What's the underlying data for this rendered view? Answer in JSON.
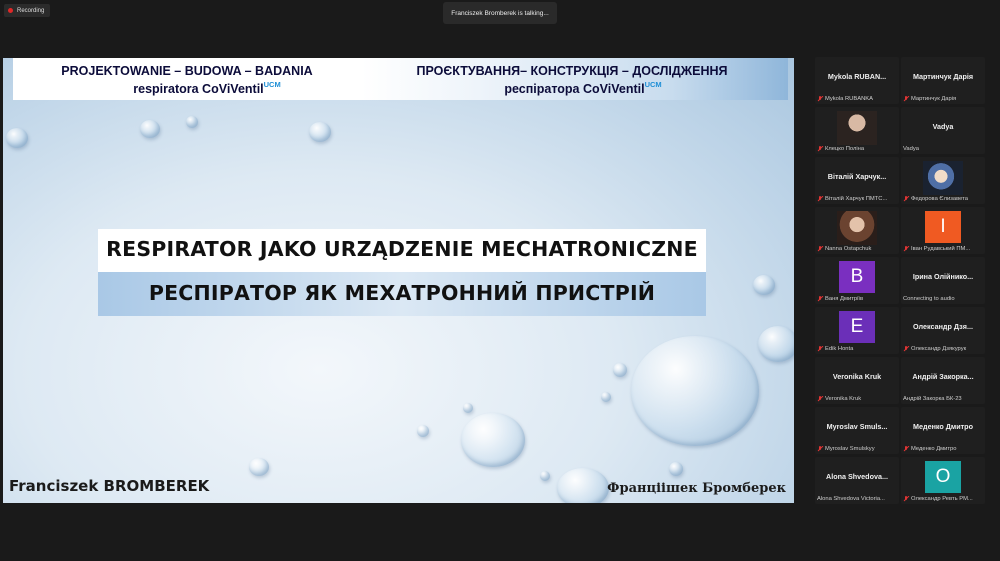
{
  "meeting": {
    "recording_label": "Recording",
    "talking_banner": "Franciszek Bromberek is talking..."
  },
  "slide": {
    "header_pl_line1": "PROJEKTOWANIE – BUDOWA – BADANIA",
    "header_pl_line2": "respiratora CoViVentil",
    "header_ua_line1": "ПРОЄКТУВАННЯ– КОНСТРУКЦІЯ – ДОСЛІДЖЕННЯ",
    "header_ua_line2": "респіратора  CoViVentil",
    "superscript": "UCM",
    "title_pl": "RESPIRATOR JAKO URZĄDZENIE MECHATRONICZNE",
    "title_ua": "РЕСПІРАТОР ЯК МЕХАТРОННИЙ ПРИСТРІЙ",
    "author_pl": "Franciszek BROMBEREK",
    "author_ua": "Франціішек Бромберек"
  },
  "participants": [
    {
      "name": "Mykola  RUBAN...",
      "label": "Mykola RUBANKA"
    },
    {
      "name": "Мартинчук Дарія",
      "label": "Мартинчук Дарія"
    },
    {
      "name": "",
      "label": "Клецко Поліна"
    },
    {
      "name": "Vadya",
      "label": "Vadya"
    },
    {
      "name": "Віталій  Харчук...",
      "label": "Віталій Харчук ПМТС..."
    },
    {
      "name": "",
      "label": "Федорова Єлизавета"
    },
    {
      "name": "",
      "label": "Nanna Ostapchuk"
    },
    {
      "name": "I",
      "label": "Іван Рудавський ПМ..."
    },
    {
      "name": "B",
      "label": "Ваня Дмитріїв"
    },
    {
      "name": "Ірина  Олійнико...",
      "label": "Connecting to audio"
    },
    {
      "name": "E",
      "label": "Edik Honta"
    },
    {
      "name": "Олександр  Дзя...",
      "label": "Олександр Дзякурук"
    },
    {
      "name": "Veronika Kruk",
      "label": "Veronika Kruk"
    },
    {
      "name": "Андрій  Закорка...",
      "label": "Андрій Закорка БК-23"
    },
    {
      "name": "Myroslav  Smuls...",
      "label": "Myroslav Smulskyy"
    },
    {
      "name": "Меденко Дмитро",
      "label": "Меденко Дмитро"
    },
    {
      "name": "Alona  Shvedova...",
      "label": "Alona Shvedova Victoria..."
    },
    {
      "name": "O",
      "label": "Олександр Ревть РМ..."
    }
  ],
  "colors": {
    "avatar_b": "#7a2fc0",
    "avatar_e": "#6b2fb8",
    "avatar_i": "#f05a22",
    "avatar_o": "#1aa3a3"
  }
}
